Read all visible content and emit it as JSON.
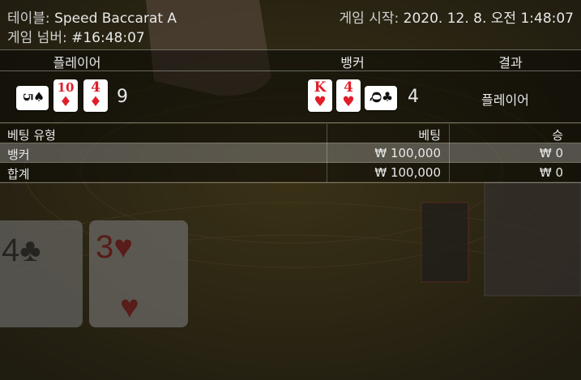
{
  "header": {
    "table_label": "테이블:",
    "table_name": "Speed Baccarat A",
    "round_label": "게임 넘버:",
    "round_id": "#16:48:07",
    "start_label": "게임 시작:",
    "start_time": "2020. 12. 8. 오전 1:48:07"
  },
  "hands": {
    "player_label": "플레이어",
    "banker_label": "뱅커",
    "result_label": "결과",
    "player_cards": [
      {
        "rank": "5",
        "suit": "♠",
        "color": "black",
        "sideways": true
      },
      {
        "rank": "10",
        "suit": "♦",
        "color": "red",
        "sideways": false
      },
      {
        "rank": "4",
        "suit": "♦",
        "color": "red",
        "sideways": false
      }
    ],
    "player_score": "9",
    "banker_cards": [
      {
        "rank": "K",
        "suit": "♥",
        "color": "red",
        "sideways": false
      },
      {
        "rank": "4",
        "suit": "♥",
        "color": "red",
        "sideways": false
      },
      {
        "rank": "Q",
        "suit": "♣",
        "color": "black",
        "sideways": true
      }
    ],
    "banker_score": "4",
    "result": "플레이어"
  },
  "bets": {
    "columns": [
      "베팅 유형",
      "베팅",
      "승"
    ],
    "rows": [
      {
        "type": "뱅커",
        "bet": "₩ 100,000",
        "win": "₩ 0"
      },
      {
        "type": "합계",
        "bet": "₩ 100,000",
        "win": "₩ 0"
      }
    ]
  },
  "colors": {
    "felt": "#3a3217",
    "card_red": "#e01e2a",
    "card_black": "#111111"
  }
}
